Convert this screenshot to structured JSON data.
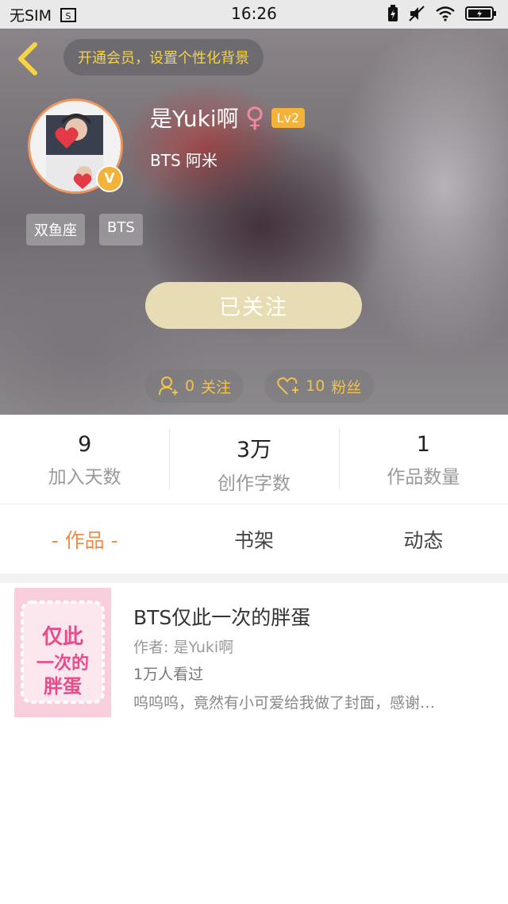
{
  "status_bar": {
    "carrier": "无SIM",
    "time": "16:26"
  },
  "header": {
    "vip_prompt": "开通会员，设置个性化背景",
    "username": "是Yuki啊",
    "gender_symbol": "♀",
    "level": "Lv2",
    "verified_badge": "V",
    "bio": "BTS 阿米",
    "tags": [
      "双鱼座",
      "BTS"
    ],
    "follow_button": "已关注",
    "following": {
      "count": "0",
      "label": "关注"
    },
    "followers": {
      "count": "10",
      "label": "粉丝"
    }
  },
  "stats": [
    {
      "value": "9",
      "label": "加入天数"
    },
    {
      "value": "3万",
      "label": "创作字数"
    },
    {
      "value": "1",
      "label": "作品数量"
    }
  ],
  "tabs": [
    {
      "label": "- 作品 -",
      "active": true
    },
    {
      "label": "书架",
      "active": false
    },
    {
      "label": "动态",
      "active": false
    }
  ],
  "books": [
    {
      "title": "BTS仅此一次的胖蛋",
      "author": "作者: 是Yuki啊",
      "views": "1万人看过",
      "description": "呜呜呜，竟然有小可爱给我做了封面，感谢…",
      "cover_text": "仅此一次的胖蛋"
    }
  ],
  "colors": {
    "accent_orange": "#f08c4a",
    "gold": "#f3b33a",
    "follow_button": "#e8dcb4",
    "vip_text": "#f5d443"
  }
}
